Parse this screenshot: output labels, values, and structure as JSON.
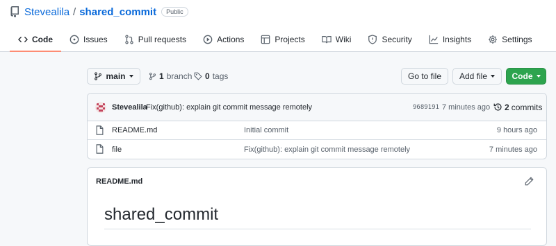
{
  "repo": {
    "owner": "Stevealila",
    "separator": "/",
    "name": "shared_commit",
    "visibility": "Public"
  },
  "tabs": [
    {
      "label": "Code",
      "icon": "code-icon",
      "active": true
    },
    {
      "label": "Issues",
      "icon": "issue-icon"
    },
    {
      "label": "Pull requests",
      "icon": "pull-request-icon"
    },
    {
      "label": "Actions",
      "icon": "play-icon"
    },
    {
      "label": "Projects",
      "icon": "table-icon"
    },
    {
      "label": "Wiki",
      "icon": "book-icon"
    },
    {
      "label": "Security",
      "icon": "shield-icon"
    },
    {
      "label": "Insights",
      "icon": "graph-icon"
    },
    {
      "label": "Settings",
      "icon": "gear-icon"
    }
  ],
  "toolbar": {
    "branch_button": "main",
    "branches_count": "1",
    "branches_label": "branch",
    "tags_count": "0",
    "tags_label": "tags",
    "go_to_file": "Go to file",
    "add_file": "Add file",
    "code": "Code"
  },
  "latest_commit": {
    "author": "Stevealila",
    "message": "Fix(github): explain git commit message remotely",
    "sha": "9689191",
    "time": "7 minutes ago",
    "count": "2",
    "count_label": "commits"
  },
  "files": [
    {
      "name": "README.md",
      "message": "Initial commit",
      "time": "9 hours ago"
    },
    {
      "name": "file",
      "message": "Fix(github): explain git commit message remotely",
      "time": "7 minutes ago"
    }
  ],
  "readme": {
    "filename": "README.md",
    "heading": "shared_commit"
  },
  "colors": {
    "accent_link": "#0969da",
    "primary_button": "#2da44e",
    "active_tab_underline": "#fd8c73"
  }
}
